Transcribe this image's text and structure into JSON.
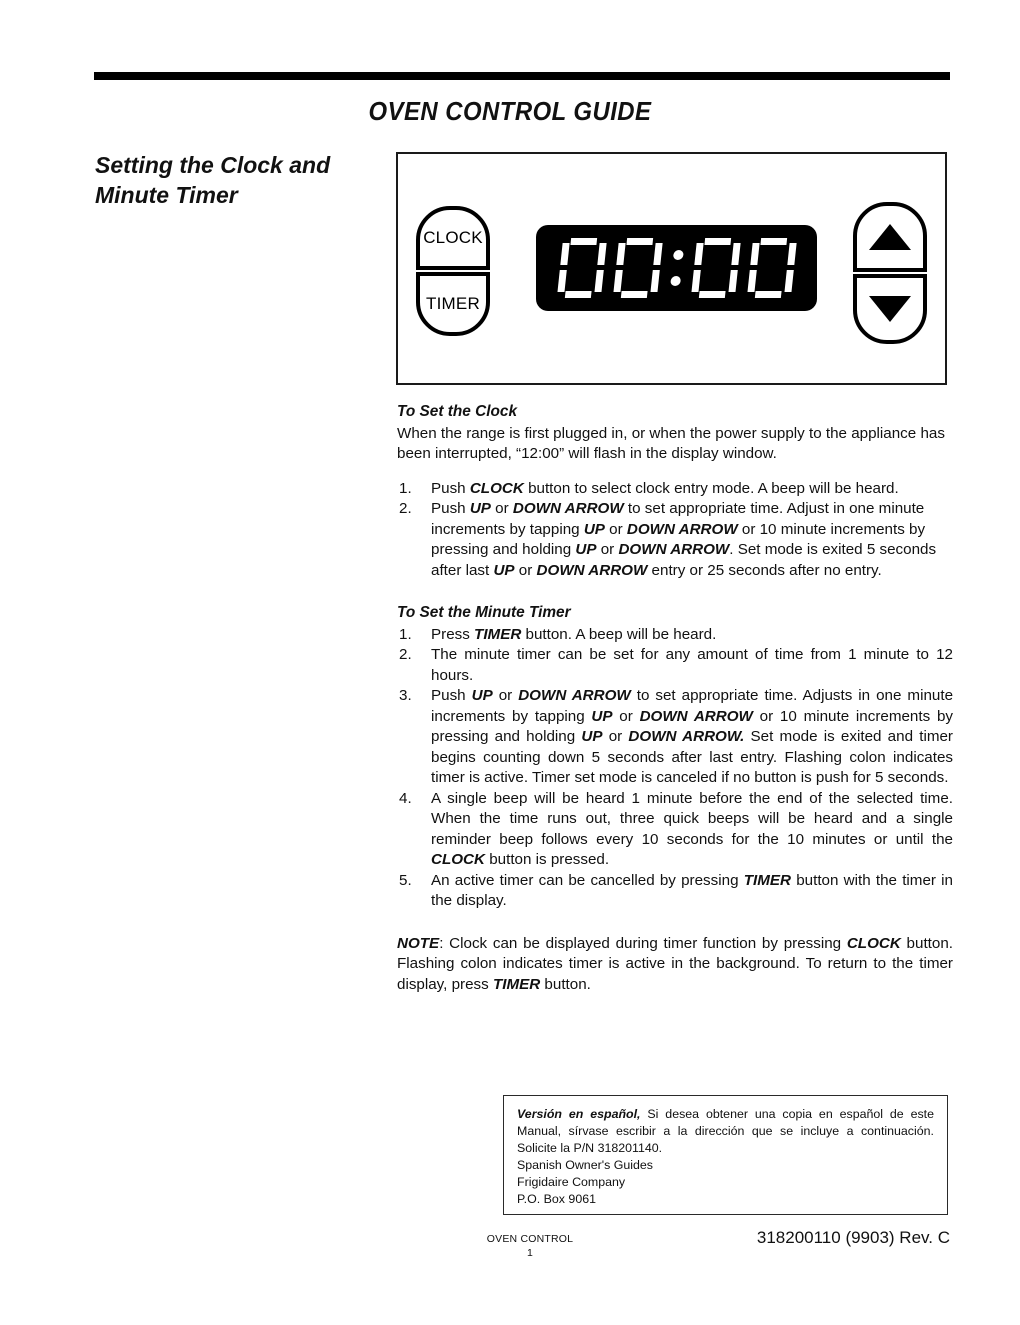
{
  "document": {
    "title": "OVEN CONTROL GUIDE",
    "section_heading": "Setting the Clock and Minute Timer"
  },
  "control_panel": {
    "clock_button_label": "CLOCK",
    "timer_button_label": "TIMER",
    "up_arrow_label": "UP ARROW",
    "down_arrow_label": "DOWN ARROW",
    "display_value": "00:00",
    "display_digits": [
      "0",
      "0",
      "0",
      "0"
    ],
    "display_separator": ":",
    "display_background": "#000000",
    "display_segment_color": "#ffffff"
  },
  "clock_section": {
    "heading": "To Set the Clock",
    "intro": "When the range is first plugged in, or when the power supply to the appliance has been interrupted, “12:00” will flash in the display window.",
    "steps": [
      {
        "num": "1.",
        "parts": [
          {
            "t": "Push ",
            "b": false
          },
          {
            "t": "CLOCK",
            "b": true
          },
          {
            "t": " button to select clock entry mode. A beep will be heard.",
            "b": false
          }
        ]
      },
      {
        "num": "2.",
        "parts": [
          {
            "t": "Push ",
            "b": false
          },
          {
            "t": "UP",
            "b": true
          },
          {
            "t": " or ",
            "b": false
          },
          {
            "t": "DOWN ARROW",
            "b": true
          },
          {
            "t": " to set appropriate time. Adjust in one minute increments by tapping ",
            "b": false
          },
          {
            "t": "UP",
            "b": true
          },
          {
            "t": " or ",
            "b": false
          },
          {
            "t": "DOWN ARROW",
            "b": true
          },
          {
            "t": " or 10 minute increments by pressing and holding ",
            "b": false
          },
          {
            "t": "UP",
            "b": true
          },
          {
            "t": " or ",
            "b": false
          },
          {
            "t": "DOWN ARROW",
            "b": true
          },
          {
            "t": ".  Set mode is exited 5 seconds after last ",
            "b": false
          },
          {
            "t": "UP",
            "b": true
          },
          {
            "t": " or ",
            "b": false
          },
          {
            "t": "DOWN ARROW",
            "b": true
          },
          {
            "t": " entry or 25 seconds after no entry.",
            "b": false
          }
        ]
      }
    ]
  },
  "timer_section": {
    "heading": "To Set the Minute Timer",
    "steps": [
      {
        "num": "1.",
        "parts": [
          {
            "t": "Press ",
            "b": false
          },
          {
            "t": "TIMER",
            "b": true
          },
          {
            "t": " button. A beep will be heard.",
            "b": false
          }
        ]
      },
      {
        "num": "2.",
        "parts": [
          {
            "t": "The minute timer can be set for any amount of time from 1 minute to 12 hours.",
            "b": false
          }
        ]
      },
      {
        "num": "3.",
        "parts": [
          {
            "t": "Push ",
            "b": false
          },
          {
            "t": "UP",
            "b": true
          },
          {
            "t": " or ",
            "b": false
          },
          {
            "t": "DOWN ARROW",
            "b": true
          },
          {
            "t": " to set appropriate time.  Adjusts in one minute increments by tapping ",
            "b": false
          },
          {
            "t": "UP",
            "b": true
          },
          {
            "t": " or ",
            "b": false
          },
          {
            "t": "DOWN ARROW",
            "b": true
          },
          {
            "t": " or 10 minute increments by pressing and holding ",
            "b": false
          },
          {
            "t": "UP",
            "b": true
          },
          {
            "t": " or ",
            "b": false
          },
          {
            "t": "DOWN ARROW.",
            "b": true
          },
          {
            "t": " Set mode is exited and timer begins counting down 5 seconds after last entry. Flashing colon indicates timer is active.  Timer set mode is canceled if no button is push for 5 seconds.",
            "b": false
          }
        ]
      },
      {
        "num": "4.",
        "parts": [
          {
            "t": "A single beep will be heard 1 minute before the end of the selected time. When the time runs out, three quick beeps will be heard and a single reminder beep follows every 10 seconds for the 10 minutes or until the ",
            "b": false
          },
          {
            "t": "CLOCK",
            "b": true
          },
          {
            "t": " button is pressed.",
            "b": false
          }
        ]
      },
      {
        "num": "5.",
        "parts": [
          {
            "t": "An active timer can be cancelled by pressing ",
            "b": false
          },
          {
            "t": "TIMER",
            "b": true
          },
          {
            "t": " button with the timer in the display.",
            "b": false
          }
        ]
      }
    ]
  },
  "note": {
    "parts": [
      {
        "t": "NOTE",
        "b": true
      },
      {
        "t": ": Clock can be displayed during timer function by pressing ",
        "b": false
      },
      {
        "t": "CLOCK",
        "b": true
      },
      {
        "t": " button. Flashing colon indicates timer is active in the background.  To return to the timer display, press ",
        "b": false
      },
      {
        "t": "TIMER",
        "b": true
      },
      {
        "t": " button.",
        "b": false
      }
    ]
  },
  "spanish_box": {
    "lead_bold": "Versión en español,",
    "lead_rest": " Si desea obtener una copia en español de este Manual, sírvase escribir a la dirección que se incluye a continuación. Solicite la P/N 318201140.",
    "address_lines": [
      "Spanish Owner's Guides",
      "Frigidaire Company",
      "P.O. Box 9061"
    ]
  },
  "footer": {
    "left_label": "OVEN CONTROL",
    "page_number": "1",
    "right_label": "318200110 (9903) Rev. C"
  }
}
